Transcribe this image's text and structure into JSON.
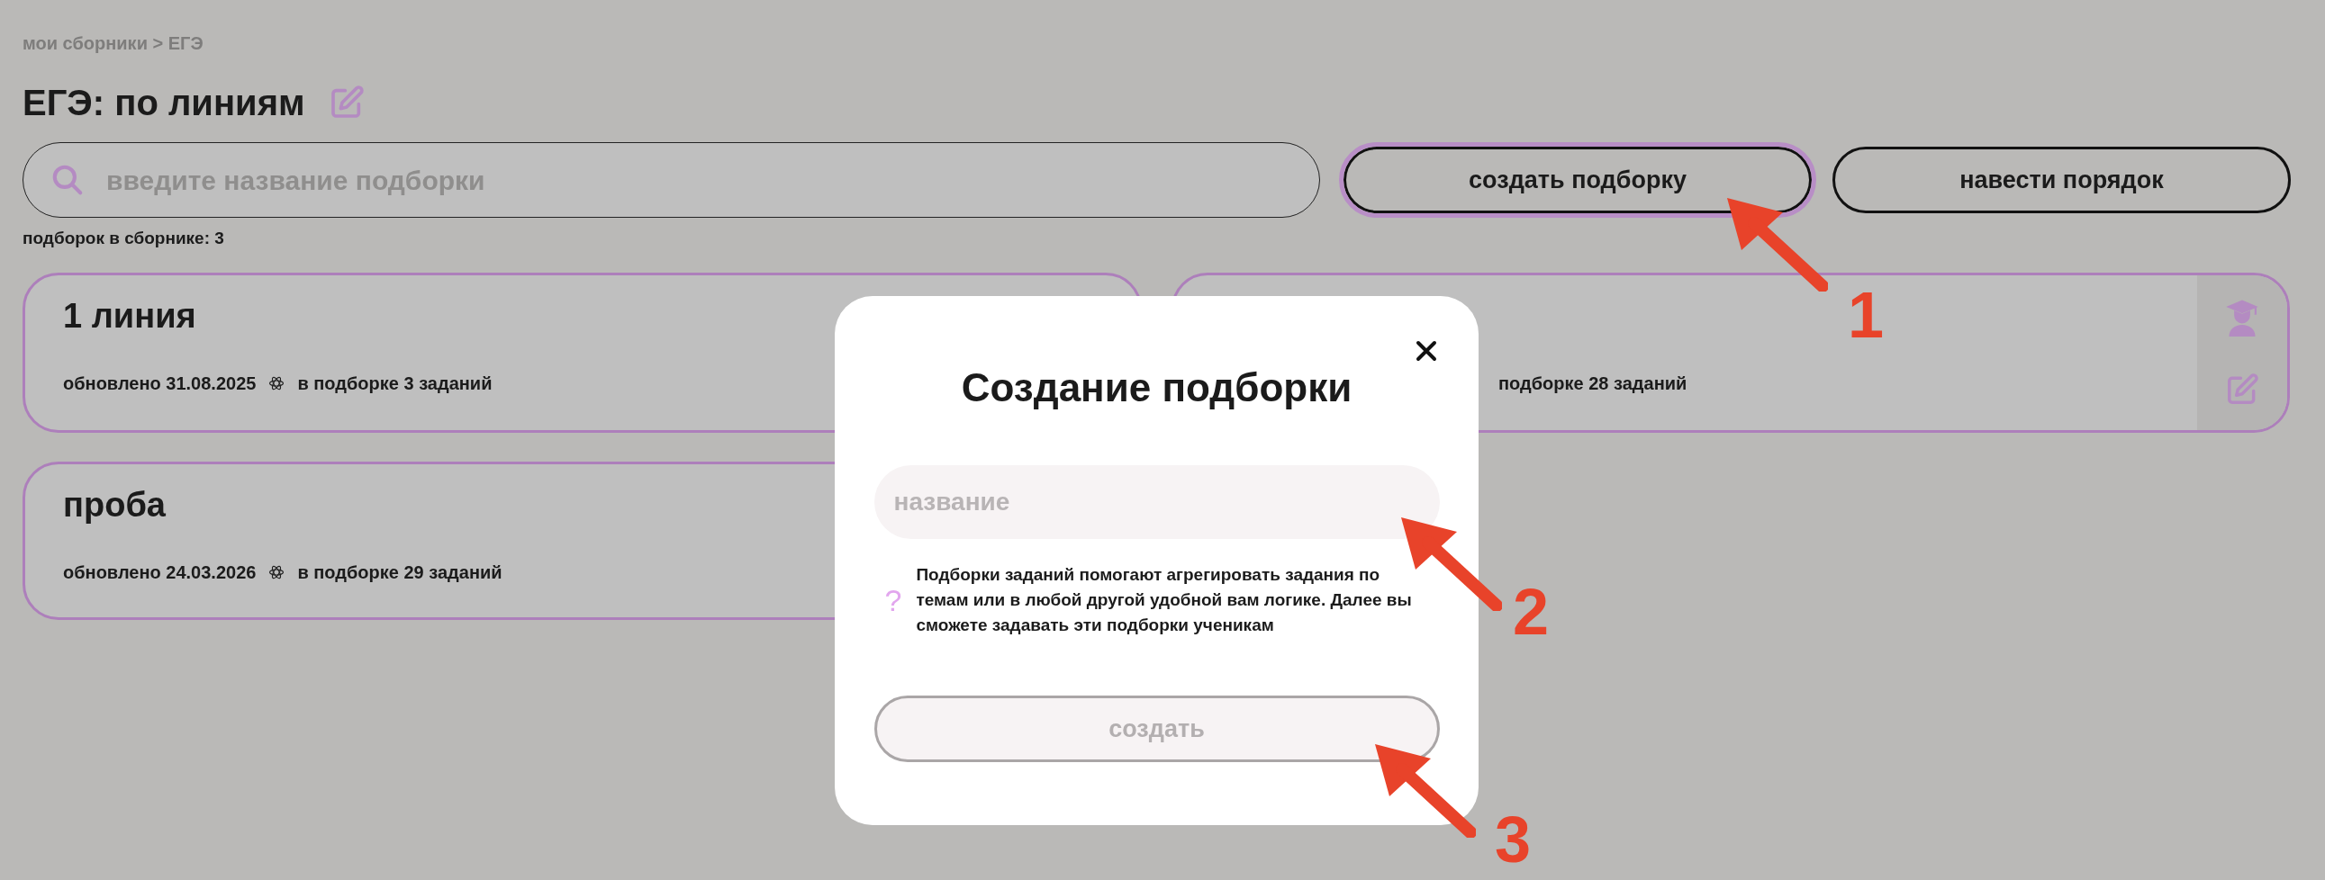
{
  "breadcrumb": "мои сборники > ЕГЭ",
  "title": "ЕГЭ: по линиям",
  "search": {
    "placeholder": "введите название подборки"
  },
  "buttons": [
    {
      "label": "создать подборку",
      "focused": true
    },
    {
      "label": "навести порядок",
      "focused": false
    }
  ],
  "count": "подборок в сборнике: 3",
  "cards": [
    {
      "title": "1 линия",
      "updated": "обновлено 31.08.2025",
      "tasks": "в подборке 3 заданий"
    },
    {
      "tasks": "подборке 28 заданий",
      "tools": true
    },
    {
      "title": "проба",
      "updated": "обновлено 24.03.2026",
      "tasks": "в подборке 29 заданий"
    }
  ],
  "modal": {
    "title": "Создание подборки",
    "field": {
      "placeholder": "название"
    },
    "help_icon": "?",
    "help": "Подборки заданий помогают агрегировать задания по темам или в любой другой удобной вам логике. Далее вы сможете задавать эти подборки ученикам",
    "submit": {
      "label": "создать",
      "disabled": true
    }
  },
  "annotations": [
    {
      "label": "1"
    },
    {
      "label": "2"
    },
    {
      "label": "3"
    }
  ]
}
